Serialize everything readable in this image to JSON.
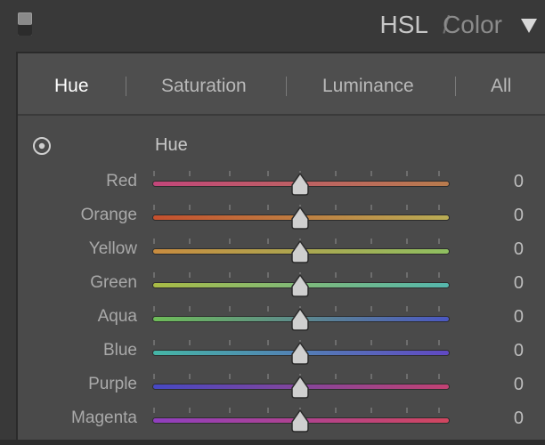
{
  "header": {
    "title_hsl": "HSL",
    "title_sep": "/",
    "title_color": "Color"
  },
  "tabs": [
    {
      "label": "Hue",
      "active": true
    },
    {
      "label": "Saturation",
      "active": false
    },
    {
      "label": "Luminance",
      "active": false
    },
    {
      "label": "All",
      "active": false
    }
  ],
  "section": {
    "label": "Hue",
    "icon": "target-adjust-icon"
  },
  "sliders": [
    {
      "label": "Red",
      "value": "0",
      "gradient": [
        "#c2467a",
        "#b87b4d"
      ]
    },
    {
      "label": "Orange",
      "value": "0",
      "gradient": [
        "#c5502e",
        "#b9ad55"
      ]
    },
    {
      "label": "Yellow",
      "value": "0",
      "gradient": [
        "#c98c3f",
        "#8fc061"
      ]
    },
    {
      "label": "Green",
      "value": "0",
      "gradient": [
        "#a9bb45",
        "#55b7ad"
      ]
    },
    {
      "label": "Aqua",
      "value": "0",
      "gradient": [
        "#6ebc58",
        "#4b58c2"
      ]
    },
    {
      "label": "Blue",
      "value": "0",
      "gradient": [
        "#45b6a6",
        "#6048c3"
      ]
    },
    {
      "label": "Purple",
      "value": "0",
      "gradient": [
        "#4648c3",
        "#c24273"
      ]
    },
    {
      "label": "Magenta",
      "value": "0",
      "gradient": [
        "#8f3fbf",
        "#d1465f"
      ]
    }
  ],
  "colors": {
    "panel_bg": "#4a4a4a",
    "header_bg": "#393939",
    "thumb": "#cfcfcf"
  }
}
